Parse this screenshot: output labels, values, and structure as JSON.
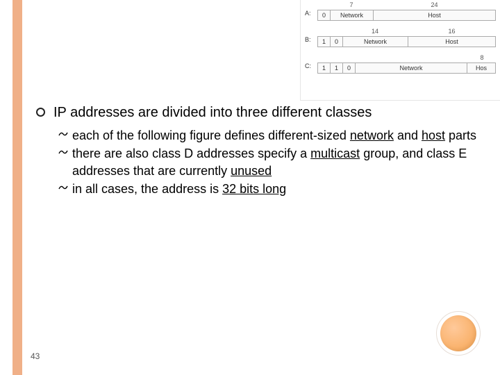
{
  "page_number": "43",
  "main_bullet": "IP addresses are divided into three different classes",
  "sub_items": [
    {
      "pre": "each of the following figure defines different-sized ",
      "u1": "network",
      "mid": " and ",
      "u2": "host",
      "post": " parts"
    },
    {
      "pre": "there are also class D addresses specify a ",
      "u1": "multicast",
      "mid": " group, and class E addresses that are currently ",
      "u2": "unused",
      "post": ""
    },
    {
      "pre": "in all cases, the address is ",
      "u1": "32 bits long",
      "mid": "",
      "u2": "",
      "post": ""
    }
  ],
  "diagram": {
    "classA": {
      "label": "A:",
      "top_left": "7",
      "top_right": "24",
      "bits": "0",
      "net": "Network",
      "host": "Host"
    },
    "classB": {
      "label": "B:",
      "top_left": "14",
      "top_right": "16",
      "bit1": "1",
      "bit2": "0",
      "net": "Network",
      "host": "Host"
    },
    "classC": {
      "label": "C:",
      "top_right": "8",
      "bit1": "1",
      "bit2": "1",
      "bit3": "0",
      "net": "Network",
      "host": "Hos"
    }
  }
}
